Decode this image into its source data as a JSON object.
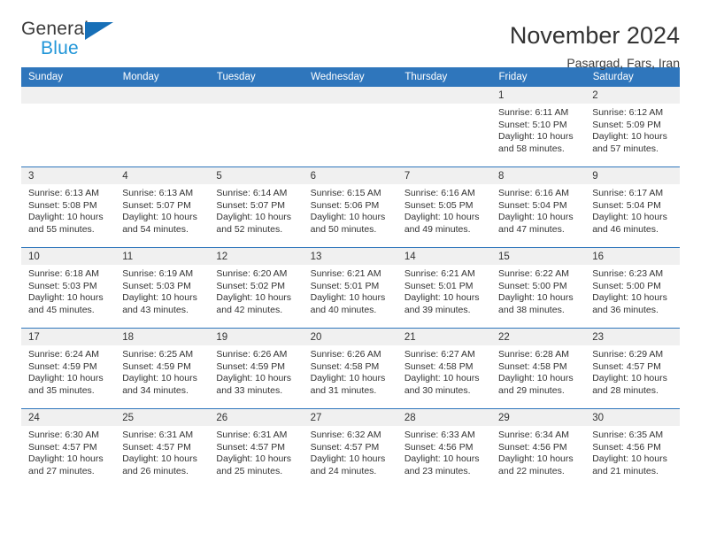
{
  "brand": {
    "name_top": "General",
    "name_bottom": "Blue",
    "triangle_color": "#176fb7",
    "blue_text_color": "#2196d8"
  },
  "header": {
    "title": "November 2024",
    "location": "Pasargad, Fars, Iran"
  },
  "theme": {
    "header_blue": "#2f76bc",
    "daynum_band": "#f0f0f0",
    "text": "#333333"
  },
  "calendar": {
    "weekday_headers": [
      "Sunday",
      "Monday",
      "Tuesday",
      "Wednesday",
      "Thursday",
      "Friday",
      "Saturday"
    ],
    "weeks": [
      [
        {
          "day": "",
          "sunrise": "",
          "sunset": "",
          "daylight1": "",
          "daylight2": "",
          "empty": true
        },
        {
          "day": "",
          "sunrise": "",
          "sunset": "",
          "daylight1": "",
          "daylight2": "",
          "empty": true
        },
        {
          "day": "",
          "sunrise": "",
          "sunset": "",
          "daylight1": "",
          "daylight2": "",
          "empty": true
        },
        {
          "day": "",
          "sunrise": "",
          "sunset": "",
          "daylight1": "",
          "daylight2": "",
          "empty": true
        },
        {
          "day": "",
          "sunrise": "",
          "sunset": "",
          "daylight1": "",
          "daylight2": "",
          "empty": true
        },
        {
          "day": "1",
          "sunrise": "Sunrise: 6:11 AM",
          "sunset": "Sunset: 5:10 PM",
          "daylight1": "Daylight: 10 hours",
          "daylight2": "and 58 minutes."
        },
        {
          "day": "2",
          "sunrise": "Sunrise: 6:12 AM",
          "sunset": "Sunset: 5:09 PM",
          "daylight1": "Daylight: 10 hours",
          "daylight2": "and 57 minutes."
        }
      ],
      [
        {
          "day": "3",
          "sunrise": "Sunrise: 6:13 AM",
          "sunset": "Sunset: 5:08 PM",
          "daylight1": "Daylight: 10 hours",
          "daylight2": "and 55 minutes."
        },
        {
          "day": "4",
          "sunrise": "Sunrise: 6:13 AM",
          "sunset": "Sunset: 5:07 PM",
          "daylight1": "Daylight: 10 hours",
          "daylight2": "and 54 minutes."
        },
        {
          "day": "5",
          "sunrise": "Sunrise: 6:14 AM",
          "sunset": "Sunset: 5:07 PM",
          "daylight1": "Daylight: 10 hours",
          "daylight2": "and 52 minutes."
        },
        {
          "day": "6",
          "sunrise": "Sunrise: 6:15 AM",
          "sunset": "Sunset: 5:06 PM",
          "daylight1": "Daylight: 10 hours",
          "daylight2": "and 50 minutes."
        },
        {
          "day": "7",
          "sunrise": "Sunrise: 6:16 AM",
          "sunset": "Sunset: 5:05 PM",
          "daylight1": "Daylight: 10 hours",
          "daylight2": "and 49 minutes."
        },
        {
          "day": "8",
          "sunrise": "Sunrise: 6:16 AM",
          "sunset": "Sunset: 5:04 PM",
          "daylight1": "Daylight: 10 hours",
          "daylight2": "and 47 minutes."
        },
        {
          "day": "9",
          "sunrise": "Sunrise: 6:17 AM",
          "sunset": "Sunset: 5:04 PM",
          "daylight1": "Daylight: 10 hours",
          "daylight2": "and 46 minutes."
        }
      ],
      [
        {
          "day": "10",
          "sunrise": "Sunrise: 6:18 AM",
          "sunset": "Sunset: 5:03 PM",
          "daylight1": "Daylight: 10 hours",
          "daylight2": "and 45 minutes."
        },
        {
          "day": "11",
          "sunrise": "Sunrise: 6:19 AM",
          "sunset": "Sunset: 5:03 PM",
          "daylight1": "Daylight: 10 hours",
          "daylight2": "and 43 minutes."
        },
        {
          "day": "12",
          "sunrise": "Sunrise: 6:20 AM",
          "sunset": "Sunset: 5:02 PM",
          "daylight1": "Daylight: 10 hours",
          "daylight2": "and 42 minutes."
        },
        {
          "day": "13",
          "sunrise": "Sunrise: 6:21 AM",
          "sunset": "Sunset: 5:01 PM",
          "daylight1": "Daylight: 10 hours",
          "daylight2": "and 40 minutes."
        },
        {
          "day": "14",
          "sunrise": "Sunrise: 6:21 AM",
          "sunset": "Sunset: 5:01 PM",
          "daylight1": "Daylight: 10 hours",
          "daylight2": "and 39 minutes."
        },
        {
          "day": "15",
          "sunrise": "Sunrise: 6:22 AM",
          "sunset": "Sunset: 5:00 PM",
          "daylight1": "Daylight: 10 hours",
          "daylight2": "and 38 minutes."
        },
        {
          "day": "16",
          "sunrise": "Sunrise: 6:23 AM",
          "sunset": "Sunset: 5:00 PM",
          "daylight1": "Daylight: 10 hours",
          "daylight2": "and 36 minutes."
        }
      ],
      [
        {
          "day": "17",
          "sunrise": "Sunrise: 6:24 AM",
          "sunset": "Sunset: 4:59 PM",
          "daylight1": "Daylight: 10 hours",
          "daylight2": "and 35 minutes."
        },
        {
          "day": "18",
          "sunrise": "Sunrise: 6:25 AM",
          "sunset": "Sunset: 4:59 PM",
          "daylight1": "Daylight: 10 hours",
          "daylight2": "and 34 minutes."
        },
        {
          "day": "19",
          "sunrise": "Sunrise: 6:26 AM",
          "sunset": "Sunset: 4:59 PM",
          "daylight1": "Daylight: 10 hours",
          "daylight2": "and 33 minutes."
        },
        {
          "day": "20",
          "sunrise": "Sunrise: 6:26 AM",
          "sunset": "Sunset: 4:58 PM",
          "daylight1": "Daylight: 10 hours",
          "daylight2": "and 31 minutes."
        },
        {
          "day": "21",
          "sunrise": "Sunrise: 6:27 AM",
          "sunset": "Sunset: 4:58 PM",
          "daylight1": "Daylight: 10 hours",
          "daylight2": "and 30 minutes."
        },
        {
          "day": "22",
          "sunrise": "Sunrise: 6:28 AM",
          "sunset": "Sunset: 4:58 PM",
          "daylight1": "Daylight: 10 hours",
          "daylight2": "and 29 minutes."
        },
        {
          "day": "23",
          "sunrise": "Sunrise: 6:29 AM",
          "sunset": "Sunset: 4:57 PM",
          "daylight1": "Daylight: 10 hours",
          "daylight2": "and 28 minutes."
        }
      ],
      [
        {
          "day": "24",
          "sunrise": "Sunrise: 6:30 AM",
          "sunset": "Sunset: 4:57 PM",
          "daylight1": "Daylight: 10 hours",
          "daylight2": "and 27 minutes."
        },
        {
          "day": "25",
          "sunrise": "Sunrise: 6:31 AM",
          "sunset": "Sunset: 4:57 PM",
          "daylight1": "Daylight: 10 hours",
          "daylight2": "and 26 minutes."
        },
        {
          "day": "26",
          "sunrise": "Sunrise: 6:31 AM",
          "sunset": "Sunset: 4:57 PM",
          "daylight1": "Daylight: 10 hours",
          "daylight2": "and 25 minutes."
        },
        {
          "day": "27",
          "sunrise": "Sunrise: 6:32 AM",
          "sunset": "Sunset: 4:57 PM",
          "daylight1": "Daylight: 10 hours",
          "daylight2": "and 24 minutes."
        },
        {
          "day": "28",
          "sunrise": "Sunrise: 6:33 AM",
          "sunset": "Sunset: 4:56 PM",
          "daylight1": "Daylight: 10 hours",
          "daylight2": "and 23 minutes."
        },
        {
          "day": "29",
          "sunrise": "Sunrise: 6:34 AM",
          "sunset": "Sunset: 4:56 PM",
          "daylight1": "Daylight: 10 hours",
          "daylight2": "and 22 minutes."
        },
        {
          "day": "30",
          "sunrise": "Sunrise: 6:35 AM",
          "sunset": "Sunset: 4:56 PM",
          "daylight1": "Daylight: 10 hours",
          "daylight2": "and 21 minutes."
        }
      ]
    ]
  }
}
